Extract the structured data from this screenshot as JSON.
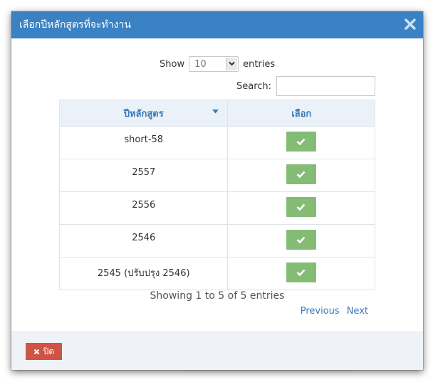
{
  "modal": {
    "title": "เลือกปีหลักสูตรที่จะทำงาน",
    "close_icon": "close-icon"
  },
  "length_menu": {
    "show_label": "Show",
    "selected_value": "10",
    "entries_label": "entries"
  },
  "search": {
    "label": "Search:",
    "value": "",
    "placeholder": ""
  },
  "table": {
    "columns": [
      "ปีหลักสูตร",
      "เลือก"
    ],
    "rows": [
      {
        "name": "short-58",
        "action_icon": "check-icon"
      },
      {
        "name": "2557",
        "action_icon": "check-icon"
      },
      {
        "name": "2556",
        "action_icon": "check-icon"
      },
      {
        "name": "2546",
        "action_icon": "check-icon"
      },
      {
        "name": "2545 (ปรับปรุง 2546)",
        "action_icon": "check-icon"
      }
    ],
    "sort_icon": "sort-desc-icon"
  },
  "info": "Showing 1 to 5 of 5 entries",
  "pagination": {
    "previous": "Previous",
    "next": "Next"
  },
  "footer": {
    "close_label": "ปิด",
    "close_icon": "times-icon"
  },
  "colors": {
    "header_bg": "#3a82c4",
    "check_button": "#84bc76",
    "close_button": "#d05446",
    "link": "#3a7ab8"
  }
}
